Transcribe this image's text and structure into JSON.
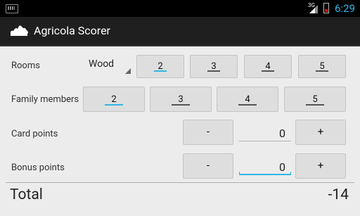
{
  "status": {
    "network": "3G",
    "time": "6:29"
  },
  "app": {
    "title": "Agricola Scorer"
  },
  "rooms": {
    "label": "Rooms",
    "material": "Wood",
    "options": [
      "2",
      "3",
      "4",
      "5"
    ],
    "selected": "2"
  },
  "family": {
    "label": "Family members",
    "options": [
      "2",
      "3",
      "4",
      "5"
    ],
    "selected": "2"
  },
  "card_points": {
    "label": "Card points",
    "minus": "-",
    "value": "0",
    "plus": "+"
  },
  "bonus_points": {
    "label": "Bonus points",
    "minus": "-",
    "value": "0",
    "plus": "+"
  },
  "total": {
    "label": "Total",
    "value": "-14"
  },
  "colors": {
    "accent": "#33b5e5",
    "actionbar": "#1f1f1f"
  }
}
